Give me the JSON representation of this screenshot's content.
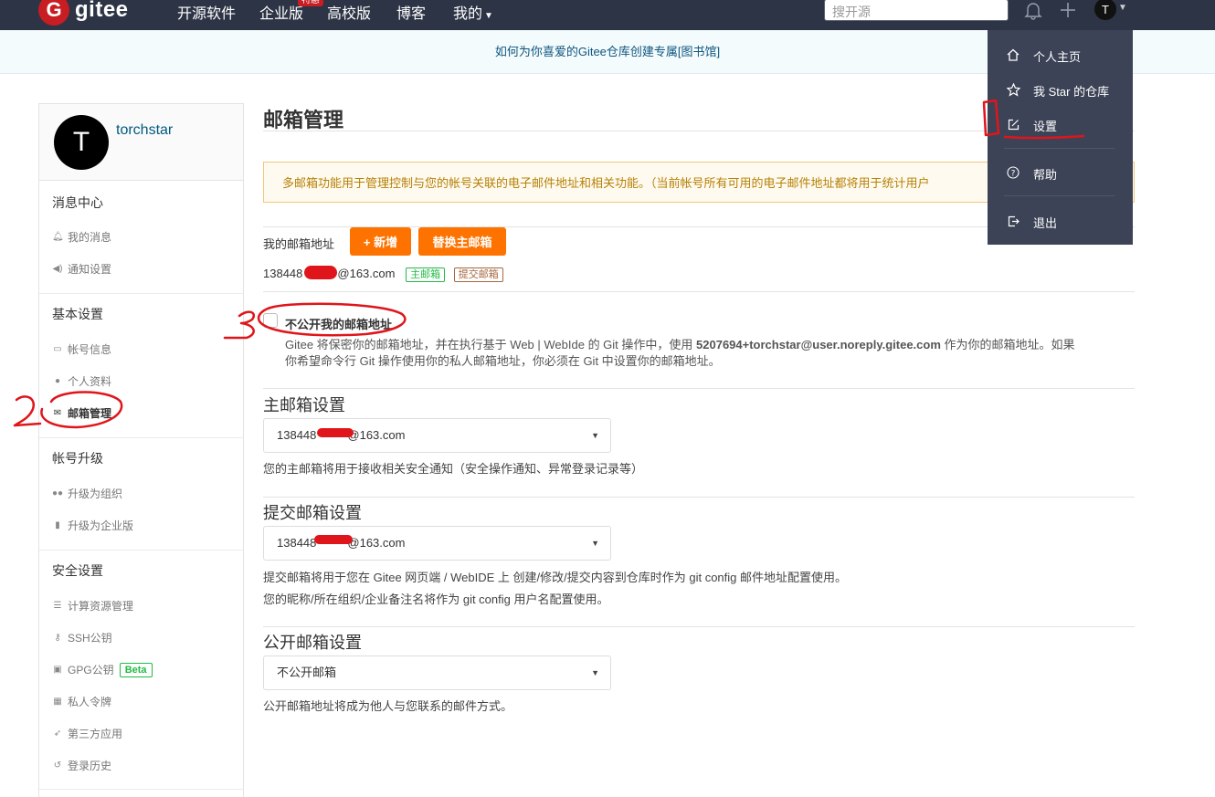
{
  "nav": {
    "logo_mark": "G",
    "logo_text": "gitee",
    "items": [
      "开源软件",
      "企业版",
      "高校版",
      "博客",
      "我的"
    ],
    "badge": "特惠",
    "search_placeholder": "搜开源",
    "avatar_letter": "T"
  },
  "announcement": "如何为你喜爱的Gitee仓库创建专属[图书馆]",
  "sidebar": {
    "avatar_letter": "T",
    "username": "torchstar",
    "sections": [
      {
        "title": "消息中心",
        "items": [
          {
            "label": "我的消息",
            "icon": "bell-icon"
          },
          {
            "label": "通知设置",
            "icon": "volume-icon"
          }
        ]
      },
      {
        "title": "基本设置",
        "items": [
          {
            "label": "帐号信息",
            "icon": "id-card-icon"
          },
          {
            "label": "个人资料",
            "icon": "user-icon"
          },
          {
            "label": "邮箱管理",
            "icon": "mail-icon"
          }
        ]
      },
      {
        "title": "帐号升级",
        "items": [
          {
            "label": "升级为组织",
            "icon": "users-icon"
          },
          {
            "label": "升级为企业版",
            "icon": "building-icon"
          }
        ]
      },
      {
        "title": "安全设置",
        "items": [
          {
            "label": "计算资源管理",
            "icon": "server-icon"
          },
          {
            "label": "SSH公钥",
            "icon": "key-icon"
          },
          {
            "label": "GPG公钥",
            "icon": "lock-icon"
          },
          {
            "label": "私人令牌",
            "icon": "token-icon"
          },
          {
            "label": "第三方应用",
            "icon": "rocket-icon"
          },
          {
            "label": "登录历史",
            "icon": "history-icon"
          }
        ]
      }
    ],
    "beta_label": "Beta"
  },
  "main": {
    "title": "邮箱管理",
    "notice": "多邮箱功能用于管理控制与您的帐号关联的电子邮件地址和相关功能。（当前帐号所有可用的电子邮件地址都将用于统计用户",
    "my_email_label": "我的邮箱地址",
    "add_button": "+ 新增",
    "replace_button": "替换主邮箱",
    "email_prefix": "138448",
    "email_suffix": "@163.com",
    "tag_primary": "主邮箱",
    "tag_commit": "提交邮箱",
    "private_checkbox_label": "不公开我的邮箱地址",
    "private_desc_1a": "Gitee 将保密你的邮箱地址，并在执行基于 Web | WebIde 的 Git 操作中，使用 ",
    "private_desc_email": "5207694+torchstar@user.noreply.gitee.com",
    "private_desc_1b": " 作为你的邮箱地址。如果",
    "private_desc_2": "你希望命令行 Git 操作使用你的私人邮箱地址，你必须在 Git 中设置你的邮箱地址。",
    "primary_title": "主邮箱设置",
    "primary_value_prefix": "138448",
    "primary_value_suffix": "@163.com",
    "primary_hint": "您的主邮箱将用于接收相关安全通知（安全操作通知、异常登录记录等）",
    "commit_title": "提交邮箱设置",
    "commit_value_prefix": "138448",
    "commit_value_suffix": "@163.com",
    "commit_hint_1": "提交邮箱将用于您在 Gitee 网页端 / WebIDE 上 创建/修改/提交内容到仓库时作为 git config 邮件地址配置使用。",
    "commit_hint_2": "您的昵称/所在组织/企业备注名将作为 git config 用户名配置使用。",
    "public_title": "公开邮箱设置",
    "public_value": "不公开邮箱",
    "public_hint": "公开邮箱地址将成为他人与您联系的邮件方式。"
  },
  "dropdown": {
    "items": [
      {
        "label": "个人主页",
        "icon": "home-icon"
      },
      {
        "label": "我 Star 的仓库",
        "icon": "star-icon"
      },
      {
        "label": "设置",
        "icon": "edit-icon"
      },
      {
        "label": "帮助",
        "icon": "help-icon"
      },
      {
        "label": "退出",
        "icon": "logout-icon"
      }
    ]
  },
  "colors": {
    "nav_bg": "#2d3445",
    "accent_orange": "#fe7300",
    "brand_red": "#c71d23",
    "annotation_red": "#e0151b"
  }
}
